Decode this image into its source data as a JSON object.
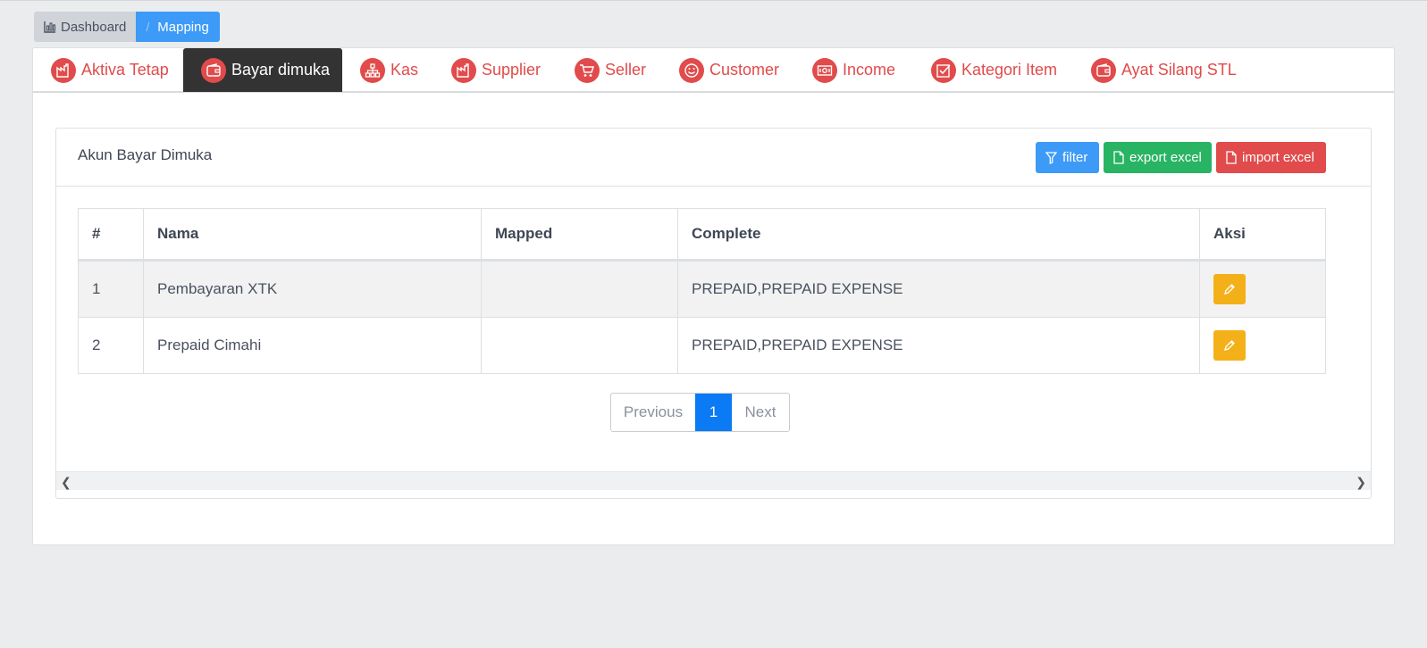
{
  "breadcrumb": {
    "home": "Dashboard",
    "separator": "/",
    "current": "Mapping"
  },
  "tabs": [
    {
      "label": "Aktiva Tetap",
      "icon": "factory-icon"
    },
    {
      "label": "Bayar dimuka",
      "icon": "wallet-icon"
    },
    {
      "label": "Kas",
      "icon": "sitemap-icon"
    },
    {
      "label": "Supplier",
      "icon": "factory-icon"
    },
    {
      "label": "Seller",
      "icon": "cart-icon"
    },
    {
      "label": "Customer",
      "icon": "smiley-icon"
    },
    {
      "label": "Income",
      "icon": "money-icon"
    },
    {
      "label": "Kategori Item",
      "icon": "checkbox-icon"
    },
    {
      "label": "Ayat Silang STL",
      "icon": "wallet-icon"
    }
  ],
  "active_tab": "Bayar dimuka",
  "panel": {
    "title": "Akun Bayar Dimuka",
    "filter_label": "filter",
    "export_label": "export excel",
    "import_label": "import excel"
  },
  "table": {
    "headers": [
      "#",
      "Nama",
      "Mapped",
      "Complete",
      "Aksi"
    ],
    "rows": [
      {
        "no": "1",
        "nama": "Pembayaran XTK",
        "mapped": "",
        "complete": "PREPAID,PREPAID EXPENSE"
      },
      {
        "no": "2",
        "nama": "Prepaid Cimahi",
        "mapped": "",
        "complete": "PREPAID,PREPAID EXPENSE"
      }
    ]
  },
  "pagination": {
    "previous": "Previous",
    "current": "1",
    "next": "Next"
  },
  "colors": {
    "primary": "#3d9bf7",
    "success": "#28b463",
    "danger": "#e14b4b",
    "warning": "#f4b019",
    "active_tab": "#333333",
    "page_active": "#0a7bf5"
  }
}
